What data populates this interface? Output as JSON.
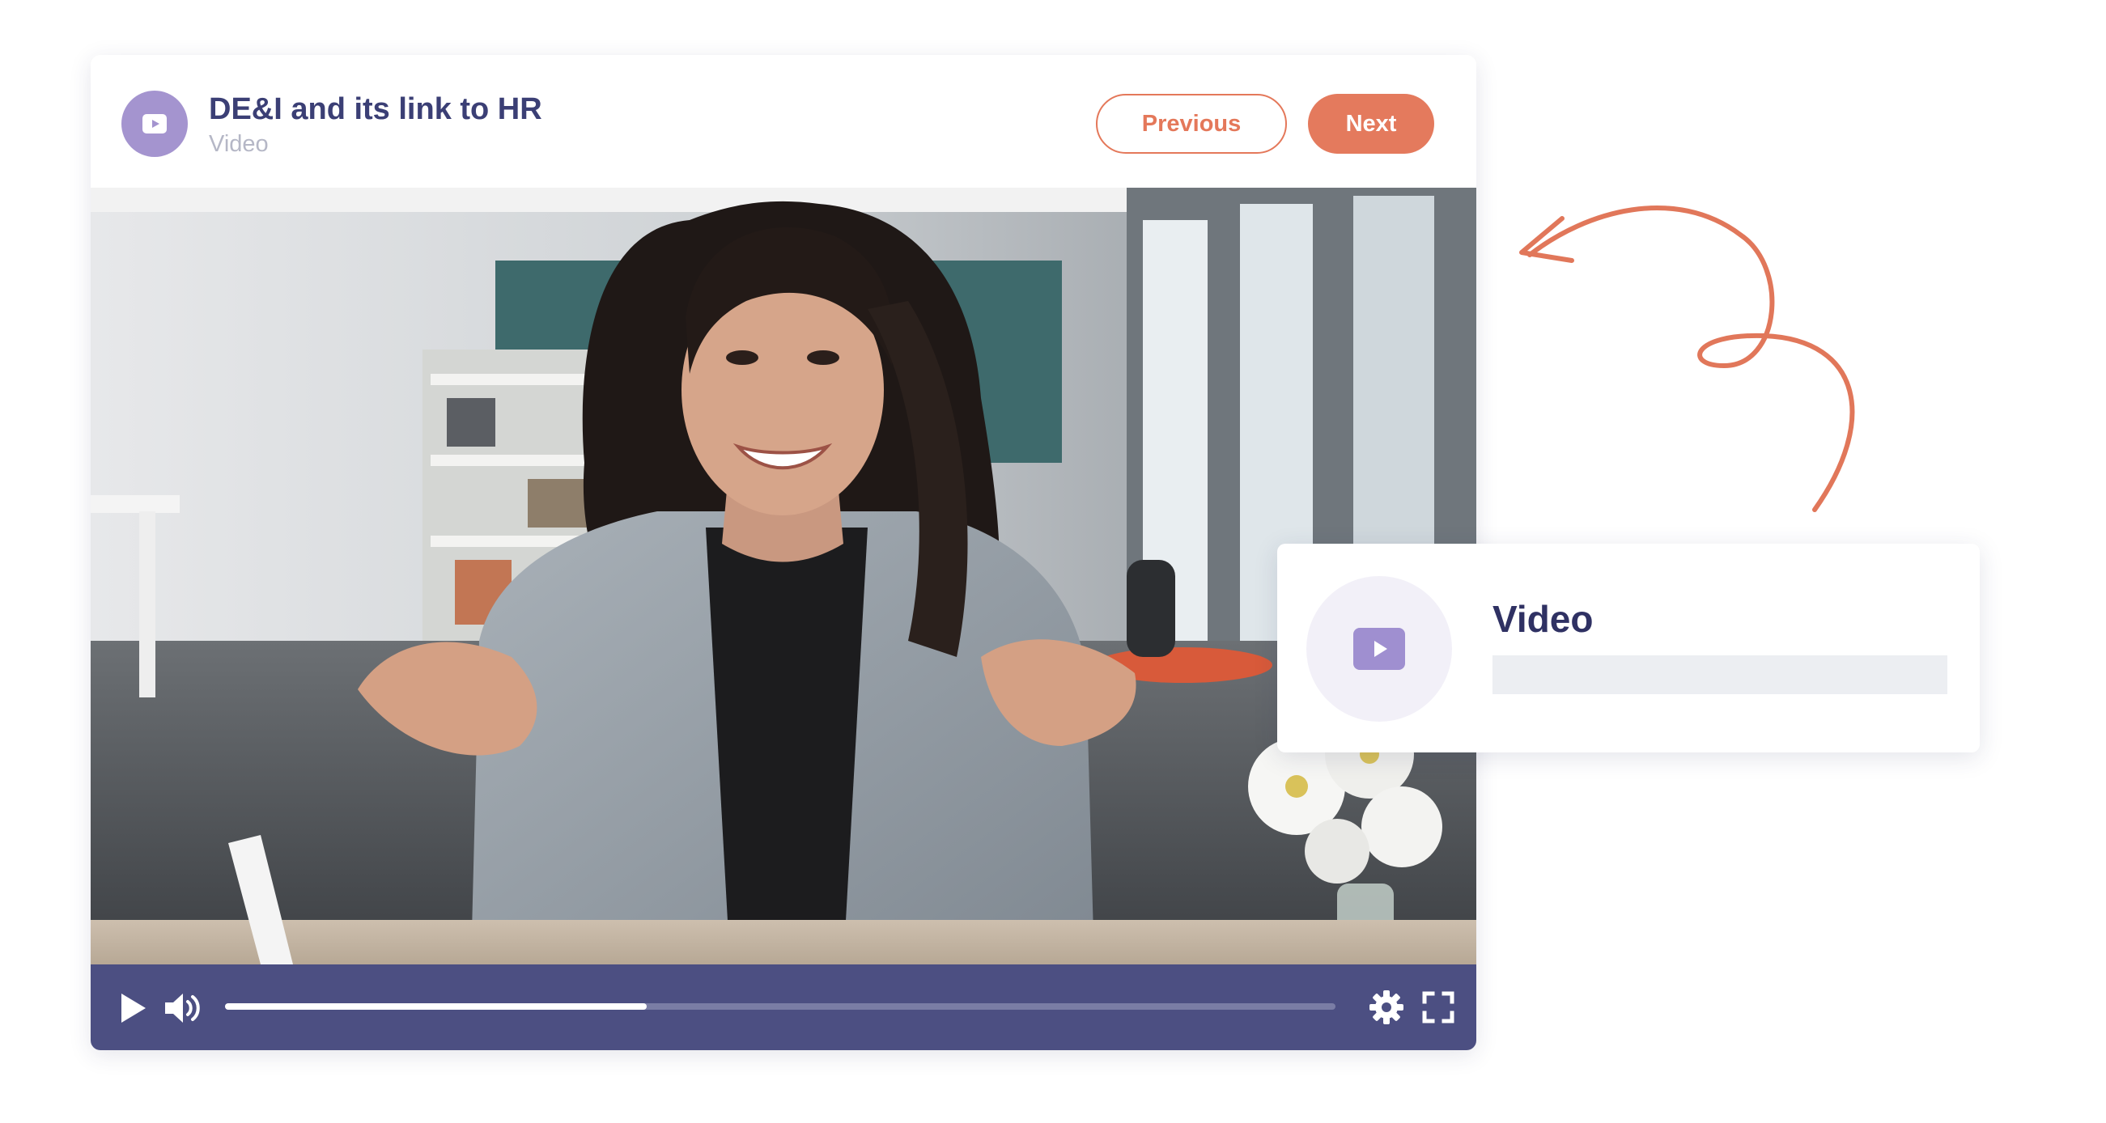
{
  "player": {
    "title": "DE&I and its link to HR",
    "type_label": "Video",
    "previous_label": "Previous",
    "next_label": "Next",
    "progress_fraction": 0.38,
    "icons": {
      "header": "video-play-icon",
      "play": "play-icon",
      "volume": "volume-icon",
      "settings": "gear-icon",
      "fullscreen": "fullscreen-icon"
    }
  },
  "side_card": {
    "title": "Video",
    "icon": "video-play-icon"
  },
  "colors": {
    "accent": "#e4785a",
    "brand_purple": "#a494cf",
    "title_navy": "#3b3f75",
    "controls_bg": "#4c4f82"
  }
}
